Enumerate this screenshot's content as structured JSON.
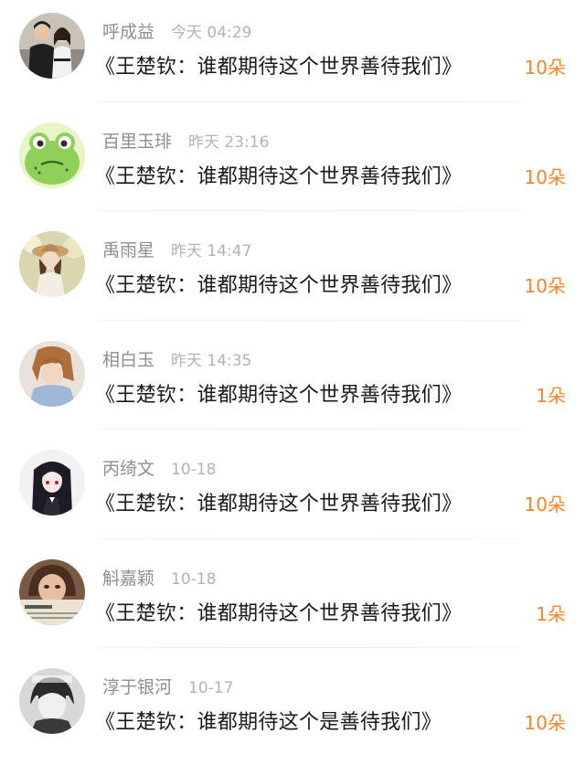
{
  "comments": [
    {
      "name": "呼成益",
      "time": "今天 04:29",
      "title": "《王楚钦：谁都期待这个世界善待我们》",
      "count": "10朵"
    },
    {
      "name": "百里玉琲",
      "time": "昨天 23:16",
      "title": "《王楚钦：谁都期待这个世界善待我们》",
      "count": "10朵"
    },
    {
      "name": "禹雨星",
      "time": "昨天 14:47",
      "title": "《王楚钦：谁都期待这个世界善待我们》",
      "count": "10朵"
    },
    {
      "name": "相白玉",
      "time": "昨天 14:35",
      "title": "《王楚钦：谁都期待这个世界善待我们》",
      "count": "1朵"
    },
    {
      "name": "丙绮文",
      "time": "10-18",
      "title": "《王楚钦：谁都期待这个世界善待我们》",
      "count": "10朵"
    },
    {
      "name": "斛嘉颖",
      "time": "10-18",
      "title": "《王楚钦：谁都期待这个世界善待我们》",
      "count": "1朵"
    },
    {
      "name": "淳于银河",
      "time": "10-17",
      "title": "《王楚钦：谁都期待这个是善待我们》",
      "count": "10朵"
    }
  ],
  "colors": {
    "accent": "#f7842e",
    "name": "#8e8e8e",
    "time": "#b3b3b3",
    "title": "#1a1a1a"
  },
  "avatar_icons": [
    "couple-photo-avatar",
    "frog-cartoon-avatar",
    "girl-hat-photo-avatar",
    "girl-blue-photo-avatar",
    "anime-girl-avatar",
    "newspaper-girl-avatar",
    "bw-boy-avatar"
  ]
}
